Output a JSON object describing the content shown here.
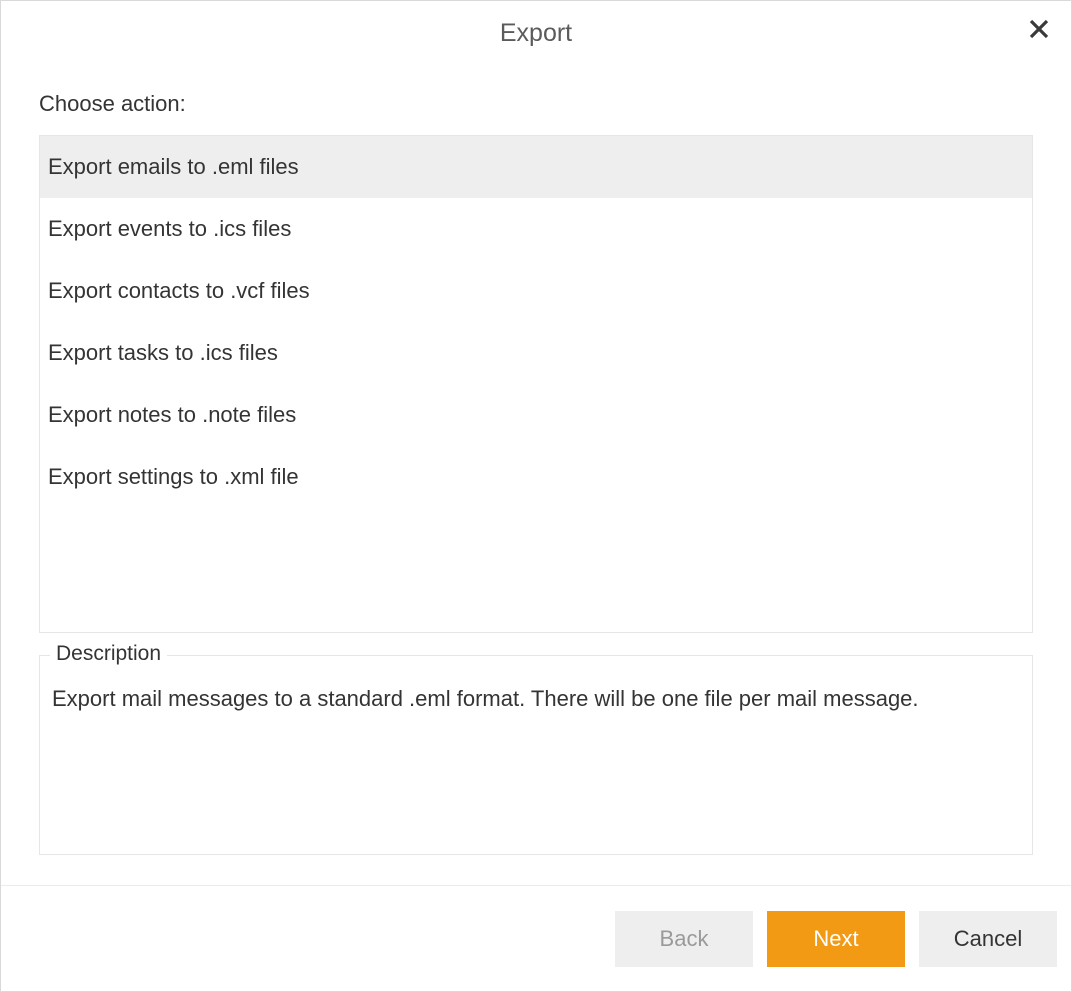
{
  "dialog": {
    "title": "Export",
    "choose_label": "Choose action:",
    "actions": [
      {
        "label": "Export emails to .eml files",
        "selected": true
      },
      {
        "label": "Export events to .ics files",
        "selected": false
      },
      {
        "label": "Export contacts to .vcf files",
        "selected": false
      },
      {
        "label": "Export tasks to .ics files",
        "selected": false
      },
      {
        "label": "Export notes to .note files",
        "selected": false
      },
      {
        "label": "Export settings to .xml file",
        "selected": false
      }
    ],
    "description": {
      "legend": "Description",
      "text": "Export mail messages to a standard .eml format. There will be one file per mail message."
    },
    "buttons": {
      "back": "Back",
      "next": "Next",
      "cancel": "Cancel"
    }
  }
}
